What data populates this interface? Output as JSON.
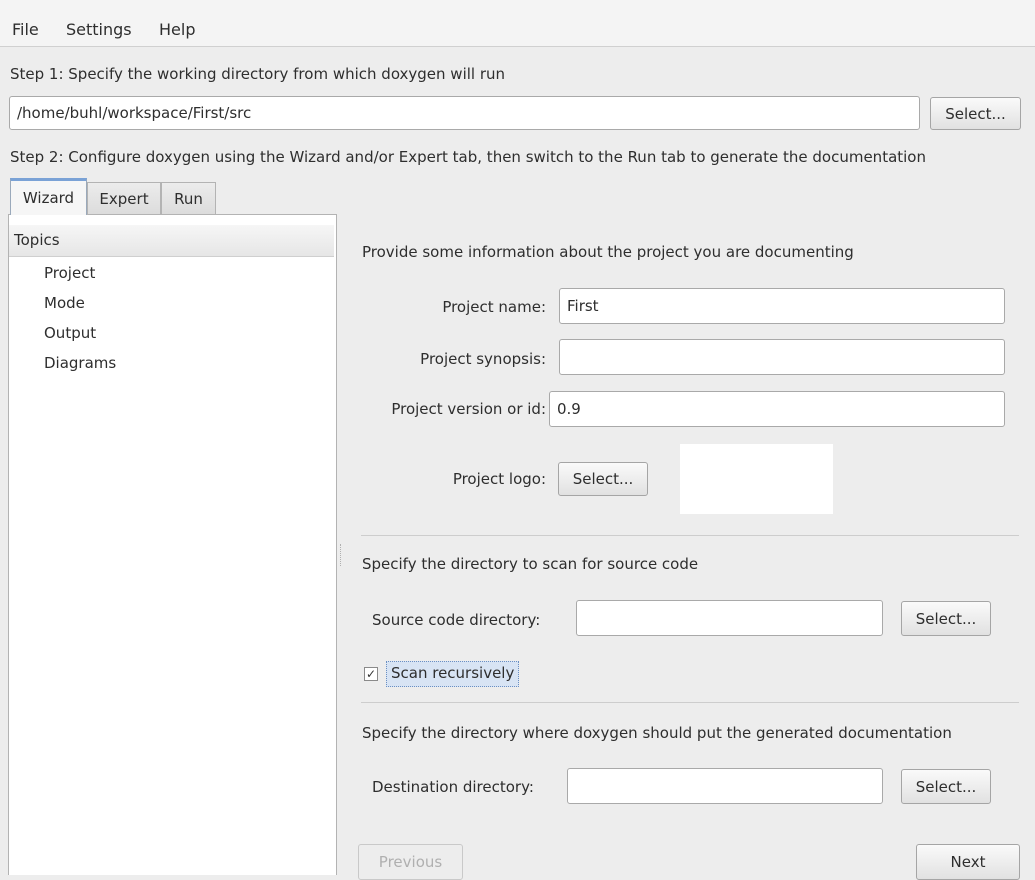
{
  "menu": {
    "file": "File",
    "settings": "Settings",
    "help": "Help"
  },
  "step1": {
    "text": "Step 1: Specify the working directory from which doxygen will run",
    "path_value": "/home/buhl/workspace/First/src",
    "select_label": "Select..."
  },
  "step2": {
    "text": "Step 2: Configure doxygen using the Wizard and/or Expert tab, then switch to the Run tab to generate the documentation"
  },
  "tabs": [
    {
      "label": "Wizard"
    },
    {
      "label": "Expert"
    },
    {
      "label": "Run"
    }
  ],
  "topics": {
    "header": "Topics",
    "items": [
      {
        "label": "Project"
      },
      {
        "label": "Mode"
      },
      {
        "label": "Output"
      },
      {
        "label": "Diagrams"
      }
    ]
  },
  "project": {
    "intro": "Provide some information about the project you are documenting",
    "name_label": "Project name:",
    "name_value": "First",
    "synopsis_label": "Project synopsis:",
    "synopsis_value": "",
    "version_label": "Project version or id:",
    "version_value": "0.9",
    "logo_label": "Project logo:",
    "logo_select": "Select..."
  },
  "source": {
    "intro": "Specify the directory to scan for source code",
    "dir_label": "Source code directory:",
    "dir_value": "",
    "select_label": "Select...",
    "scan_recursive_label": "Scan recursively",
    "scan_recursive_checked": true,
    "check_glyph": "✓"
  },
  "destination": {
    "intro": "Specify the directory where doxygen should put the generated documentation",
    "dir_label": "Destination directory:",
    "dir_value": "",
    "select_label": "Select..."
  },
  "nav": {
    "previous": "Previous",
    "next": "Next"
  },
  "colors": {
    "tab_accent": "#7aa2d6",
    "check_highlight": "#d8e4f4"
  }
}
